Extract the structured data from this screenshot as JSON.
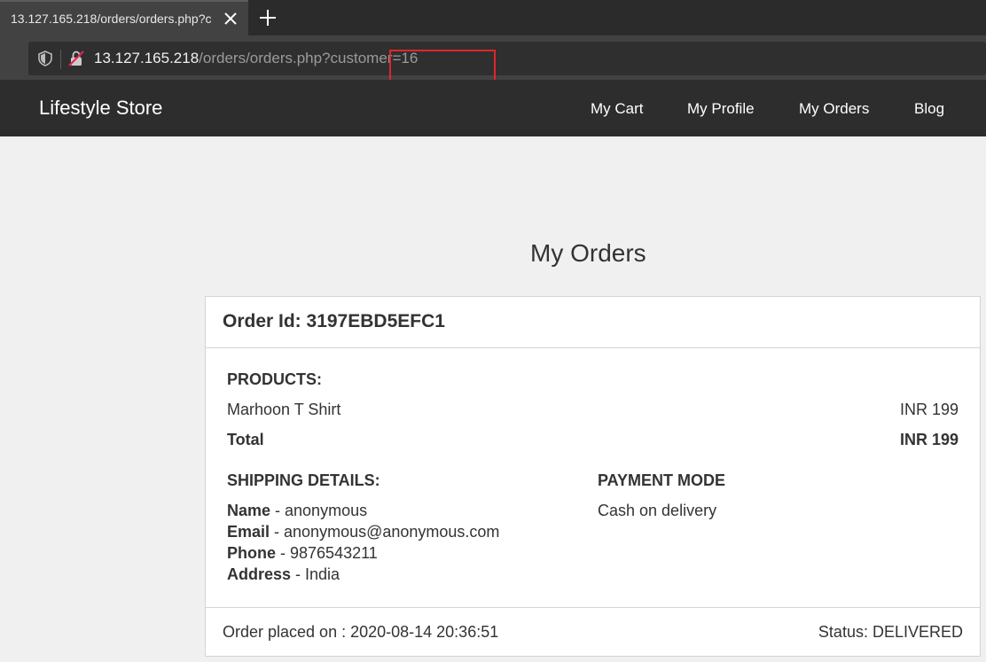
{
  "browser": {
    "tab_title": "13.127.165.218/orders/orders.php?c",
    "url_host": "13.127.165.218",
    "url_path": "/orders/orders.php",
    "url_query": "?customer=16"
  },
  "site": {
    "brand": "Lifestyle Store",
    "nav": {
      "cart": "My Cart",
      "profile": "My Profile",
      "orders": "My Orders",
      "blog": "Blog"
    }
  },
  "page": {
    "title": "My Orders"
  },
  "order": {
    "id_label": "Order Id: 3197EBD5EFC1",
    "products_heading": "PRODUCTS:",
    "product_name": "Marhoon T Shirt",
    "product_price": "INR 199",
    "total_label": "Total",
    "total_value": "INR 199",
    "shipping_heading": "SHIPPING DETAILS:",
    "name_label": "Name",
    "name_value": " - anonymous",
    "email_label": "Email",
    "email_value": " - anonymous@anonymous.com",
    "phone_label": "Phone",
    "phone_value": " - 9876543211",
    "address_label": "Address",
    "address_value": " - India",
    "payment_heading": "PAYMENT MODE",
    "payment_value": "Cash on delivery",
    "placed_on": "Order placed on : 2020-08-14 20:36:51",
    "status": "Status: DELIVERED"
  },
  "colors": {
    "highlight": "#e0262a",
    "navbar": "#2d2d2d",
    "page_bg": "#f0f0f0"
  }
}
